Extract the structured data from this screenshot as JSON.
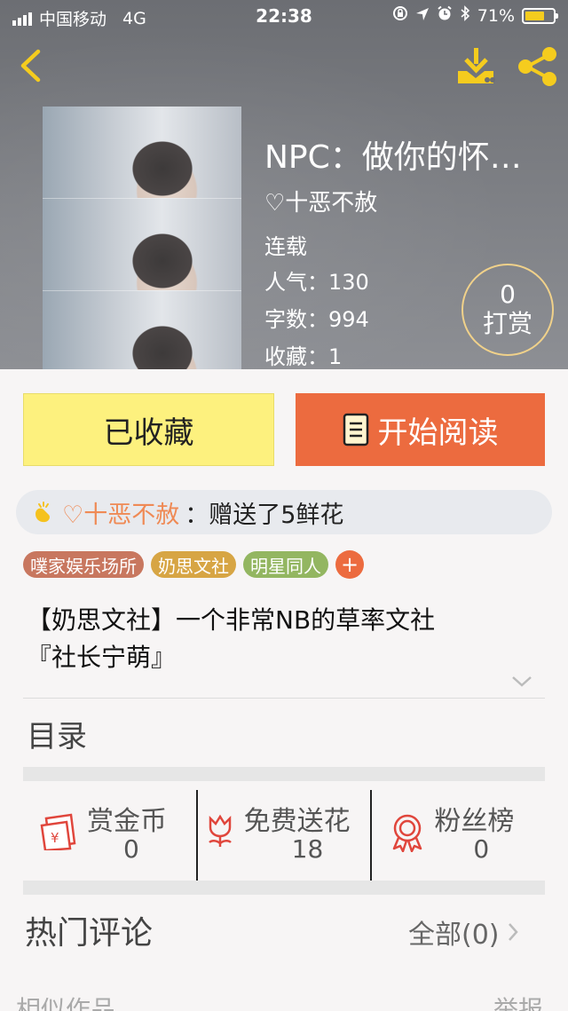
{
  "status_bar": {
    "carrier": "中国移动",
    "network": "4G",
    "time": "22:38",
    "battery": "71%",
    "battery_level": 0.71
  },
  "book": {
    "title": "NPC：做你的怀…",
    "author": "♡十恶不赦",
    "status": "连载",
    "popularity": "人气：130",
    "word_count": "字数：994",
    "favorites": "收藏：1"
  },
  "tip": {
    "count": "0",
    "label": "打赏"
  },
  "actions": {
    "collect_label": "已收藏",
    "read_label": "开始阅读"
  },
  "flower_notice": {
    "donor": "♡十恶不赦",
    "message": "：赠送了5鲜花"
  },
  "tags": [
    {
      "label": "噗家娱乐场所",
      "color": "#c8775f"
    },
    {
      "label": "奶思文社",
      "color": "#d7a544"
    },
    {
      "label": "明星同人",
      "color": "#93b661"
    }
  ],
  "description": {
    "line1": "【奶思文社】一个非常NB的草率文社",
    "line2": "『社长宁萌』"
  },
  "toc_label": "目录",
  "stats": [
    {
      "label": "赏金币",
      "value": "0",
      "icon": "red-envelope-icon"
    },
    {
      "label": "免费送花",
      "value": "18",
      "icon": "flower-icon"
    },
    {
      "label": "粉丝榜",
      "value": "0",
      "icon": "award-ribbon-icon"
    }
  ],
  "comments": {
    "title": "热门评论",
    "all_label": "全部(0)"
  },
  "footer": {
    "similar_label": "相似作品",
    "report_label": "举报"
  },
  "colors": {
    "accent_orange": "#ec6b3f",
    "collect_yellow": "#fdf17e",
    "icon_yellow": "#f5cc1e",
    "icon_red": "#e0463c"
  }
}
